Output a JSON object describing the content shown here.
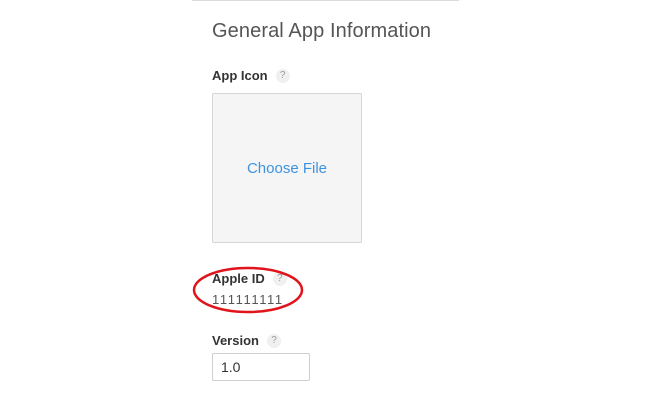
{
  "section": {
    "title": "General App Information"
  },
  "app_icon": {
    "label": "App Icon",
    "help": "?",
    "choose_file_label": "Choose File"
  },
  "apple_id": {
    "label": "Apple ID",
    "help": "?",
    "value": "111111111"
  },
  "version": {
    "label": "Version",
    "help": "?",
    "value": "1.0"
  },
  "colors": {
    "link": "#3d93e0",
    "highlight_oval": "#e0141a"
  }
}
